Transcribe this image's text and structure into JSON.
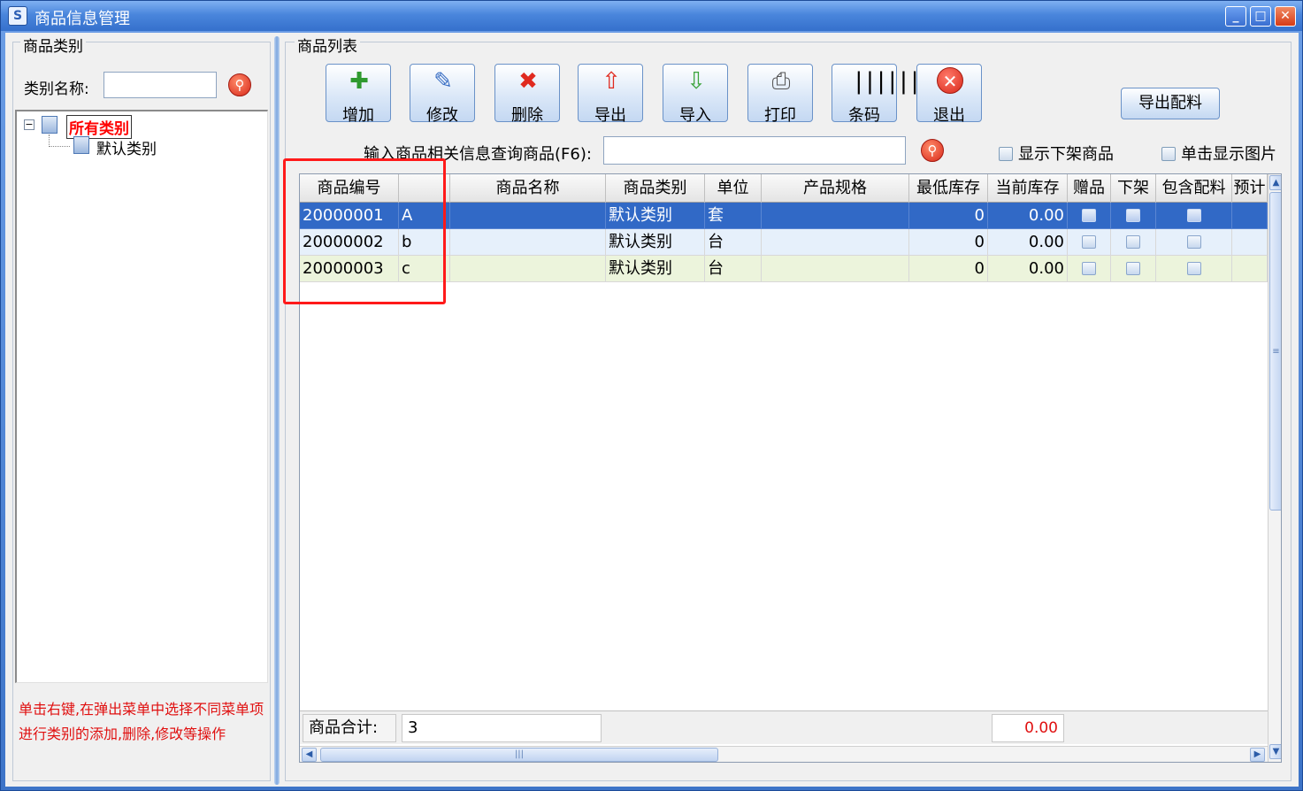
{
  "window": {
    "title": "商品信息管理",
    "icon": "app-icon",
    "min_glyph": "_",
    "max_glyph": "□",
    "close_glyph": "✕"
  },
  "left": {
    "group_title": "商品类别",
    "category_label": "类别名称:",
    "category_value": "",
    "tree_root": "所有类别",
    "tree_child": "默认类别",
    "hint": "单击右键,在弹出菜单中选择不同菜单项进行类别的添加,删除,修改等操作"
  },
  "right": {
    "group_title": "商品列表",
    "toolbar": [
      {
        "id": "add",
        "label": "增加",
        "icon": "add-icon",
        "glyph": "✚"
      },
      {
        "id": "edit",
        "label": "修改",
        "icon": "edit-icon",
        "glyph": "✎"
      },
      {
        "id": "delete",
        "label": "删除",
        "icon": "delete-icon",
        "glyph": "✖"
      },
      {
        "id": "export",
        "label": "导出",
        "icon": "export-icon",
        "glyph": "⇧"
      },
      {
        "id": "import",
        "label": "导入",
        "icon": "import-icon",
        "glyph": "⇩"
      },
      {
        "id": "print",
        "label": "打印",
        "icon": "print-icon",
        "glyph": "⎙"
      },
      {
        "id": "barcode",
        "label": "条码",
        "icon": "barcode-icon",
        "glyph": "||||||"
      },
      {
        "id": "exit",
        "label": "退出",
        "icon": "exit-icon",
        "glyph": "✕"
      }
    ],
    "export_ingredients": "导出配料",
    "search_label": "输入商品相关信息查询商品(F6):",
    "search_value": "",
    "show_offshelf": "显示下架商品",
    "show_image": "单击显示图片"
  },
  "grid": {
    "columns": [
      "商品编号",
      "",
      "商品名称",
      "商品类别",
      "单位",
      "产品规格",
      "最低库存",
      "当前库存",
      "赠品",
      "下架",
      "包含配料",
      "预计"
    ],
    "rows": [
      {
        "code": "20000001",
        "name_short": "A",
        "name": "",
        "category": "默认类别",
        "unit": "套",
        "spec": "",
        "min_stock": "0",
        "cur_stock": "0.00"
      },
      {
        "code": "20000002",
        "name_short": "b",
        "name": "",
        "category": "默认类别",
        "unit": "台",
        "spec": "",
        "min_stock": "0",
        "cur_stock": "0.00"
      },
      {
        "code": "20000003",
        "name_short": "c",
        "name": "",
        "category": "默认类别",
        "unit": "台",
        "spec": "",
        "min_stock": "0",
        "cur_stock": "0.00"
      }
    ],
    "footer_label": "商品合计:",
    "footer_count": "3",
    "footer_sum": "0.00"
  },
  "colors": {
    "selection": "#3169c6",
    "highlight_box": "#ff1a1a",
    "hint_text": "#e01010"
  }
}
